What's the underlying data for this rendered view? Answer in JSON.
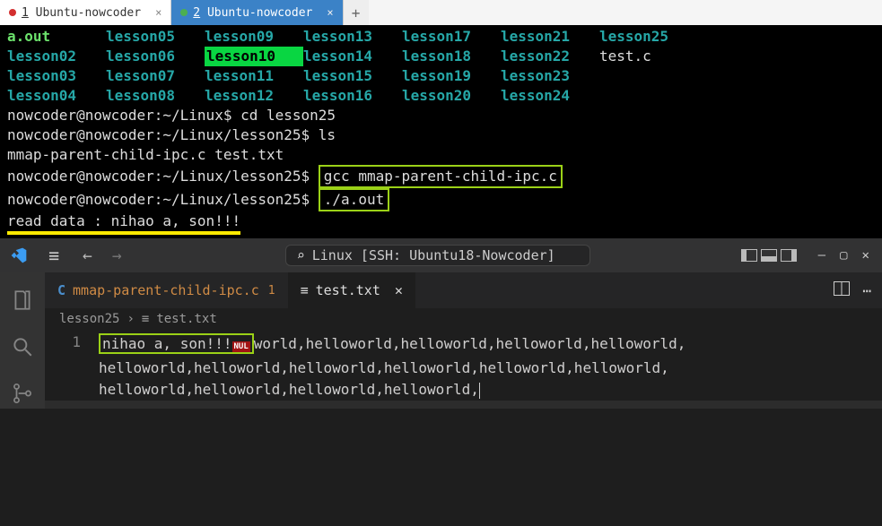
{
  "term_tabs": [
    {
      "n": "1",
      "label": "Ubuntu-nowcoder",
      "color": "#d32f2f",
      "active": false
    },
    {
      "n": "2",
      "label": "Ubuntu-nowcoder",
      "color": "#4caf50",
      "active": true
    }
  ],
  "ls": {
    "row0": [
      "a.out",
      "lesson05",
      "lesson09",
      "lesson13",
      "lesson17",
      "lesson21",
      "lesson25"
    ],
    "row1": [
      "lesson02",
      "lesson06",
      "lesson10",
      "lesson14",
      "lesson18",
      "lesson22",
      "test.c"
    ],
    "row2": [
      "lesson03",
      "lesson07",
      "lesson11",
      "lesson15",
      "lesson19",
      "lesson23",
      ""
    ],
    "row3": [
      "lesson04",
      "lesson08",
      "lesson12",
      "lesson16",
      "lesson20",
      "lesson24",
      ""
    ]
  },
  "p1": "nowcoder@nowcoder:~/Linux$ ",
  "c1": "cd lesson25",
  "p2": "nowcoder@nowcoder:~/Linux/lesson25$ ",
  "c2": "ls",
  "ls2": "mmap-parent-child-ipc.c  test.txt",
  "c3": "gcc mmap-parent-child-ipc.c",
  "c4": "./a.out",
  "out": "read data : nihao a, son!!!",
  "vsc": {
    "search": "Linux [SSH: Ubuntu18-Nowcoder]",
    "tab1": "mmap-parent-child-ipc.c",
    "tab1n": "1",
    "tab2": "test.txt",
    "crumb1": "lesson25",
    "crumb2": "test.txt",
    "line_no": "1",
    "frag_hl": "nihao a, son!!!",
    "nul": "NUL",
    "frag_l1": "world,helloworld,helloworld,helloworld,helloworld,",
    "frag_l2": "helloworld,helloworld,helloworld,helloworld,helloworld,helloworld,",
    "frag_l3": "helloworld,helloworld,helloworld,helloworld,"
  }
}
